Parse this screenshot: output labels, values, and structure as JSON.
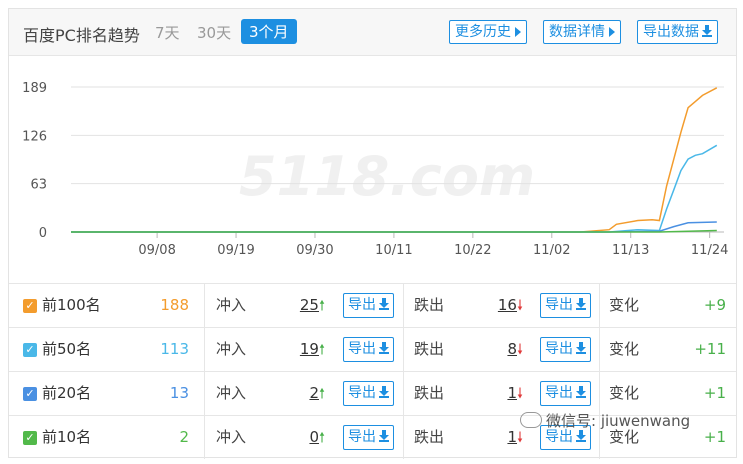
{
  "header": {
    "title": "百度PC排名趋势",
    "ranges": [
      "7天",
      "30天",
      "3个月"
    ],
    "active_range": "3个月",
    "buttons": {
      "history": "更多历史",
      "details": "数据详情",
      "export": "导出数据"
    }
  },
  "chart_data": {
    "type": "line",
    "watermark": "5118.com",
    "y_ticks": [
      "189",
      "126",
      "63",
      "0"
    ],
    "x_ticks": [
      "09/08",
      "09/19",
      "09/30",
      "10/11",
      "10/22",
      "11/02",
      "11/13",
      "11/24"
    ],
    "ylim": [
      0,
      189
    ],
    "x_start": "2017-08-27",
    "x_end": "2017-11-26",
    "grid": true,
    "series": [
      {
        "name": "前100名",
        "color": "#f39c2d",
        "x": [
          "2017-11-06",
          "2017-11-10",
          "2017-11-11",
          "2017-11-14",
          "2017-11-16",
          "2017-11-17",
          "2017-11-18",
          "2017-11-19",
          "2017-11-20",
          "2017-11-21",
          "2017-11-22",
          "2017-11-23",
          "2017-11-25"
        ],
        "y": [
          0,
          3,
          10,
          15,
          16,
          15,
          60,
          95,
          130,
          162,
          170,
          178,
          188
        ]
      },
      {
        "name": "前50名",
        "color": "#4ab8e8",
        "x": [
          "2017-11-10",
          "2017-11-14",
          "2017-11-17",
          "2017-11-18",
          "2017-11-19",
          "2017-11-20",
          "2017-11-21",
          "2017-11-22",
          "2017-11-23",
          "2017-11-25"
        ],
        "y": [
          0,
          3,
          2,
          30,
          55,
          80,
          95,
          100,
          102,
          113
        ]
      },
      {
        "name": "前20名",
        "color": "#4a90e2",
        "x": [
          "2017-11-10",
          "2017-11-17",
          "2017-11-19",
          "2017-11-21",
          "2017-11-25"
        ],
        "y": [
          0,
          1,
          7,
          12,
          13
        ]
      },
      {
        "name": "前10名",
        "color": "#52b94a",
        "x": [
          "2017-11-17",
          "2017-11-21",
          "2017-11-25"
        ],
        "y": [
          0,
          1,
          2
        ]
      }
    ]
  },
  "table": {
    "rows": [
      {
        "label": "前100名",
        "count": "188",
        "count_color": "#f39c2d",
        "check_color": "#f39c2d",
        "rush_label": "冲入",
        "rush": "25",
        "drop_label": "跌出",
        "drop": "16",
        "change_label": "变化",
        "change": "+9"
      },
      {
        "label": "前50名",
        "count": "113",
        "count_color": "#4ab8e8",
        "check_color": "#4ab8e8",
        "rush_label": "冲入",
        "rush": "19",
        "drop_label": "跌出",
        "drop": "8",
        "change_label": "变化",
        "change": "+11"
      },
      {
        "label": "前20名",
        "count": "13",
        "count_color": "#4a90e2",
        "check_color": "#4a90e2",
        "rush_label": "冲入",
        "rush": "2",
        "drop_label": "跌出",
        "drop": "1",
        "change_label": "变化",
        "change": "+1"
      },
      {
        "label": "前10名",
        "count": "2",
        "count_color": "#52b94a",
        "check_color": "#52b94a",
        "rush_label": "冲入",
        "rush": "0",
        "drop_label": "跌出",
        "drop": "1",
        "change_label": "变化",
        "change": "+1"
      }
    ],
    "export_label": "导出"
  },
  "watermark_text": "微信号: jiuwenwang"
}
